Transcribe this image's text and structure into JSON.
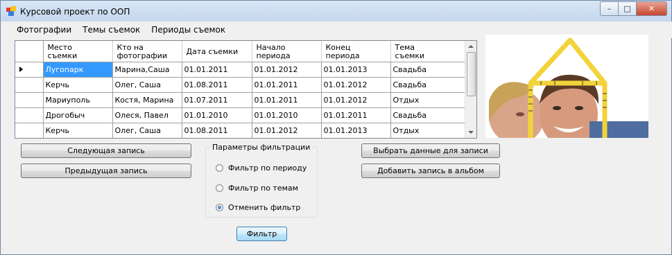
{
  "window": {
    "title": "Курсовой проект по ООП"
  },
  "menu": {
    "items": [
      "Фотографии",
      "Темы съемок",
      "Периоды съемок"
    ]
  },
  "grid": {
    "columns": [
      "Место\nсъемки",
      "Кто на\nфотографии",
      "Дата съемки",
      "Начало\nпериода",
      "Конец\nпериода",
      "Тема\nсъемки"
    ],
    "rows": [
      [
        "Лугопарк",
        "Марина,Саша",
        "01.01.2011",
        "01.01.2012",
        "01.01.2013",
        "Свадьба"
      ],
      [
        "Керчь",
        "Олег, Саша",
        "01.08.2011",
        "01.01.2011",
        "01.01.2012",
        "Свадьба"
      ],
      [
        "Мариуполь",
        "Костя, Марина",
        "01.07.2011",
        "01.01.2011",
        "01.01.2012",
        "Отдых"
      ],
      [
        "Дрогобыч",
        "Олеся, Павел",
        "01.01.2010",
        "01.01.2010",
        "01.01.2011",
        "Свадьба"
      ],
      [
        "Керчь",
        "Олег, Саша",
        "01.08.2011",
        "01.01.2012",
        "01.01.2013",
        "Отдых"
      ]
    ],
    "selected_row": 0
  },
  "buttons": {
    "next": "Следующая запись",
    "prev": "Предыдущая запись",
    "select_data": "Выбрать данные для записи",
    "add_record": "Добавить запись в альбом",
    "filter": "Фильтр"
  },
  "filter_group": {
    "title": "Параметры фильтрации",
    "options": [
      {
        "label": "Фильтр по периоду",
        "checked": false
      },
      {
        "label": "Фильтр по темам",
        "checked": false
      },
      {
        "label": "Отменить фильтр",
        "checked": true
      }
    ]
  },
  "colors": {
    "selection": "#3399ff",
    "tape": "#f2d33a"
  }
}
